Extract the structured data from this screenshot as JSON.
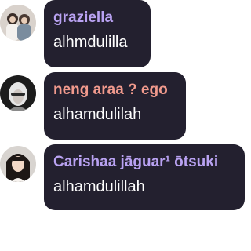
{
  "messages": [
    {
      "username": "graziella",
      "username_color": "#b9a2f2",
      "text": "alhmdulilla",
      "avatar": "user-avatar-icon"
    },
    {
      "username": "neng araa ? ego",
      "username_color": "#f19a8d",
      "text": "alhamdulilah",
      "avatar": "user-avatar-icon"
    },
    {
      "username": "Carishaa jāguar¹ ōtsuki",
      "username_color": "#b9a2f2",
      "text": "alhamdulillah",
      "avatar": "user-avatar-icon"
    }
  ]
}
